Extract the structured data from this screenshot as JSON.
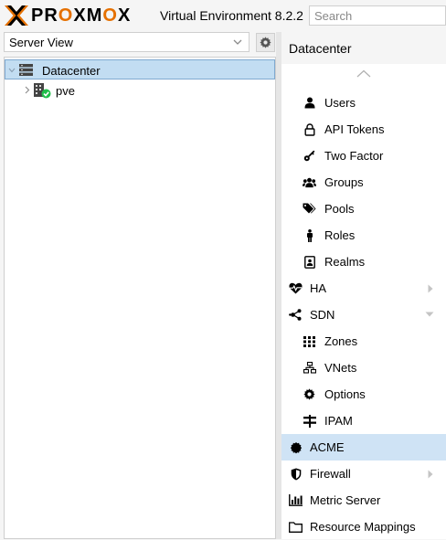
{
  "header": {
    "brand": "PROXMOX",
    "version": "Virtual Environment 8.2.2",
    "search_placeholder": "Search"
  },
  "left": {
    "view_selector": "Server View",
    "tree": [
      {
        "label": "Datacenter",
        "selected": true
      },
      {
        "label": "pve",
        "selected": false
      }
    ]
  },
  "right": {
    "title": "Datacenter",
    "menu": [
      {
        "label": "Users",
        "icon": "user-icon",
        "level": 2
      },
      {
        "label": "API Tokens",
        "icon": "lock-icon",
        "level": 2
      },
      {
        "label": "Two Factor",
        "icon": "key-icon",
        "level": 2
      },
      {
        "label": "Groups",
        "icon": "users-icon",
        "level": 2
      },
      {
        "label": "Pools",
        "icon": "tags-icon",
        "level": 2
      },
      {
        "label": "Roles",
        "icon": "male-icon",
        "level": 2
      },
      {
        "label": "Realms",
        "icon": "id-badge-icon",
        "level": 2
      },
      {
        "label": "HA",
        "icon": "heartbeat-icon",
        "level": 1,
        "arrow": "right"
      },
      {
        "label": "SDN",
        "icon": "sdn-icon",
        "level": 1,
        "arrow": "down"
      },
      {
        "label": "Zones",
        "icon": "grid-icon",
        "level": 2
      },
      {
        "label": "VNets",
        "icon": "network-icon",
        "level": 2
      },
      {
        "label": "Options",
        "icon": "gear-icon",
        "level": 2
      },
      {
        "label": "IPAM",
        "icon": "ipam-icon",
        "level": 2
      },
      {
        "label": "ACME",
        "icon": "certificate-icon",
        "level": 1,
        "selected": true
      },
      {
        "label": "Firewall",
        "icon": "shield-icon",
        "level": 1,
        "arrow": "right"
      },
      {
        "label": "Metric Server",
        "icon": "bar-chart-icon",
        "level": 1
      },
      {
        "label": "Resource Mappings",
        "icon": "folder-icon",
        "level": 1
      }
    ]
  },
  "colors": {
    "brand_orange": "#e57000",
    "selection": "#c2ddf2",
    "status_ok": "#21bf4b"
  }
}
